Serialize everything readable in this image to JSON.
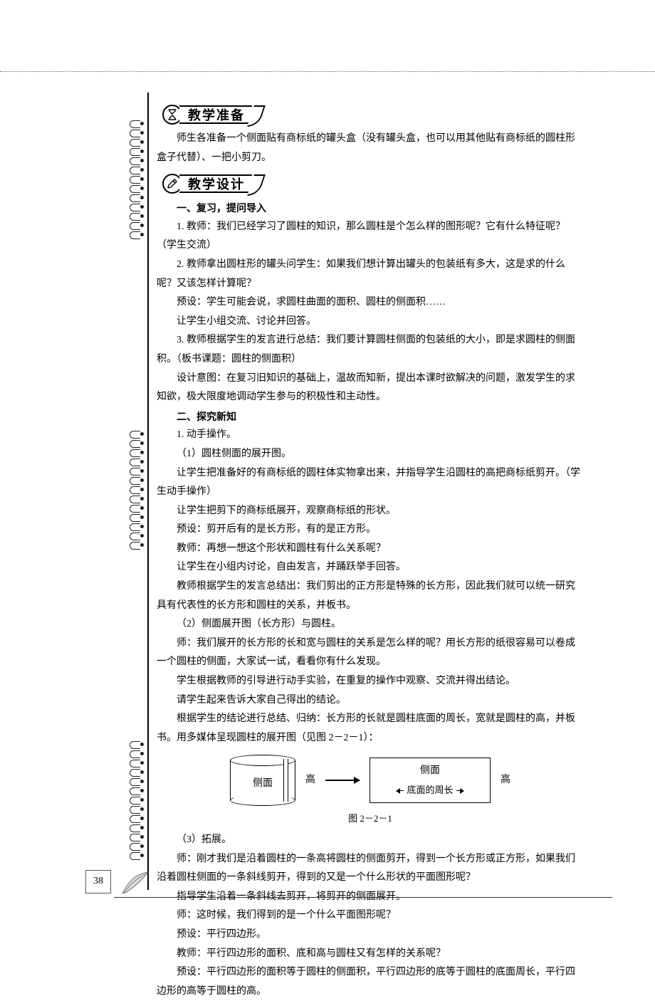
{
  "sections": {
    "prep": {
      "title": "教学准备",
      "p1": "师生各准备一个侧面贴有商标纸的罐头盒（没有罐头盒，也可以用其他贴有商标纸的圆柱形盒子代替）、一把小剪刀。"
    },
    "design": {
      "title": "教学设计",
      "h1": "一、复习，提问导入",
      "p1": "1. 教师：我们已经学习了圆柱的知识，那么圆柱是个怎么样的图形呢？它有什么特征呢？（学生交流）",
      "p2": "2. 教师拿出圆柱形的罐头问学生：如果我们想计算出罐头的包装纸有多大，这是求的什么呢？又该怎样计算呢？",
      "p3": "预设：学生可能会说，求圆柱曲面的面积、圆柱的侧面积……",
      "p4": "让学生小组交流、讨论并回答。",
      "p5": "3. 教师根据学生的发言进行总结：我们要计算圆柱侧面的包装纸的大小，即是求圆柱的侧面积。（板书课题：圆柱的侧面积）",
      "p6": "设计意图：在复习旧知识的基础上，温故而知新，提出本课时欲解决的问题，激发学生的求知欲，极大限度地调动学生参与的积极性和主动性。",
      "h2": "二、探究新知",
      "p7": "1. 动手操作。",
      "p8": "（1）圆柱侧面的展开图。",
      "p9": "让学生把准备好的有商标纸的圆柱体实物拿出来，并指导学生沿圆柱的高把商标纸剪开。（学生动手操作）",
      "p10": "让学生把剪下的商标纸展开，观察商标纸的形状。",
      "p11": "预设：剪开后有的是长方形，有的是正方形。",
      "p12": "教师：再想一想这个形状和圆柱有什么关系呢？",
      "p13": "让学生在小组内讨论，自由发言，并踊跃举手回答。",
      "p14": "教师根据学生的发言总结出：我们剪出的正方形是特殊的长方形，因此我们就可以统一研究具有代表性的长方形和圆柱的关系，并板书。",
      "p15": "（2）侧面展开图（长方形）与圆柱。",
      "p16": "师：我们展开的长方形的长和宽与圆柱的关系是怎么样的呢？用长方形的纸很容易可以卷成一个圆柱的侧面，大家试一试，看看你有什么发现。",
      "p17": "学生根据教师的引导进行动手实验，在重复的操作中观察、交流并得出结论。",
      "p18": "请学生起来告诉大家自己得出的结论。",
      "p19": "根据学生的结论进行总结、归纳：长方形的长就是圆柱底面的周长，宽就是圆柱的高，并板书。用多媒体呈现圆柱的展开图（见图 2－2－1）：",
      "fig": {
        "cyl_label": "侧面",
        "height_label": "高",
        "rect_side": "侧面",
        "rect_bottom": "底面的周长",
        "rect_height": "高",
        "caption": "图 2－2－1"
      },
      "p20": "（3）拓展。",
      "p21": "师：刚才我们是沿着圆柱的一条高将圆柱的侧面剪开，得到一个长方形或正方形，如果我们沿着圆柱侧面的一条斜线剪开，得到的又是一个什么形状的平面图形呢？",
      "p22": "指导学生沿着一条斜线去剪开，将剪开的侧面展开。",
      "p23": "师：这时候，我们得到的是一个什么平面图形呢？",
      "p24": "预设：平行四边形。",
      "p25": "教师：平行四边形的面积、底和高与圆柱又有怎样的关系呢？",
      "p26": "预设：平行四边形的面积等于圆柱的侧面积，平行四边形的底等于圆柱的底面周长，平行四边形的高等于圆柱的高。"
    }
  },
  "page_number": "38"
}
